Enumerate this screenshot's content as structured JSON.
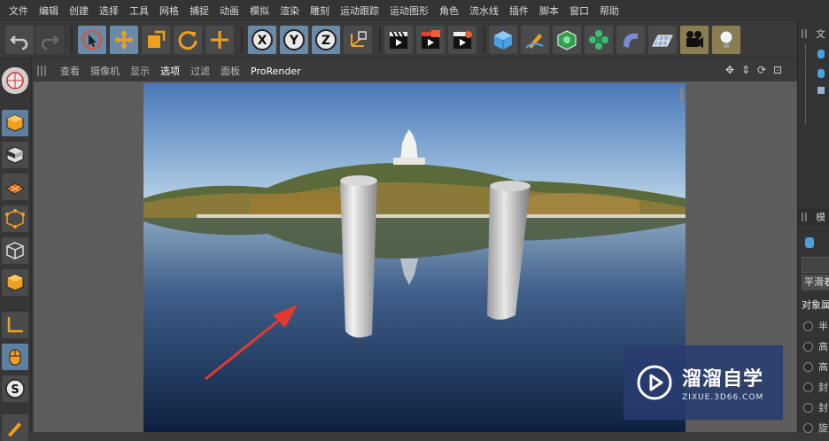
{
  "menu": [
    "文件",
    "编辑",
    "创建",
    "选择",
    "工具",
    "网格",
    "捕捉",
    "动画",
    "模拟",
    "渲染",
    "雕刻",
    "运动跟踪",
    "运动图形",
    "角色",
    "流水线",
    "插件",
    "脚本",
    "窗口",
    "帮助"
  ],
  "viewport_menu": [
    "查看",
    "摄像机",
    "显示",
    "选项",
    "过滤",
    "面板"
  ],
  "viewport_menu_active": "选项",
  "viewport_extra": "ProRender",
  "axis_labels": {
    "x": "X",
    "y": "Y",
    "z": "Z"
  },
  "left_tool_s_label": "S",
  "right_panel": {
    "tab1": "文",
    "tab2": "模",
    "label_flat": "平滑着",
    "label_attr": "对象属",
    "radio_items": [
      "半",
      "高",
      "高",
      "封",
      "封",
      "旋"
    ]
  },
  "watermark": {
    "title": "溜溜自学",
    "subtitle": "ZIXUE.3D66.COM"
  },
  "colors": {
    "accent_blue": "#6a8aa8",
    "arrow_red": "#e23a2e",
    "watermark_bg": "#2a3c6e"
  }
}
